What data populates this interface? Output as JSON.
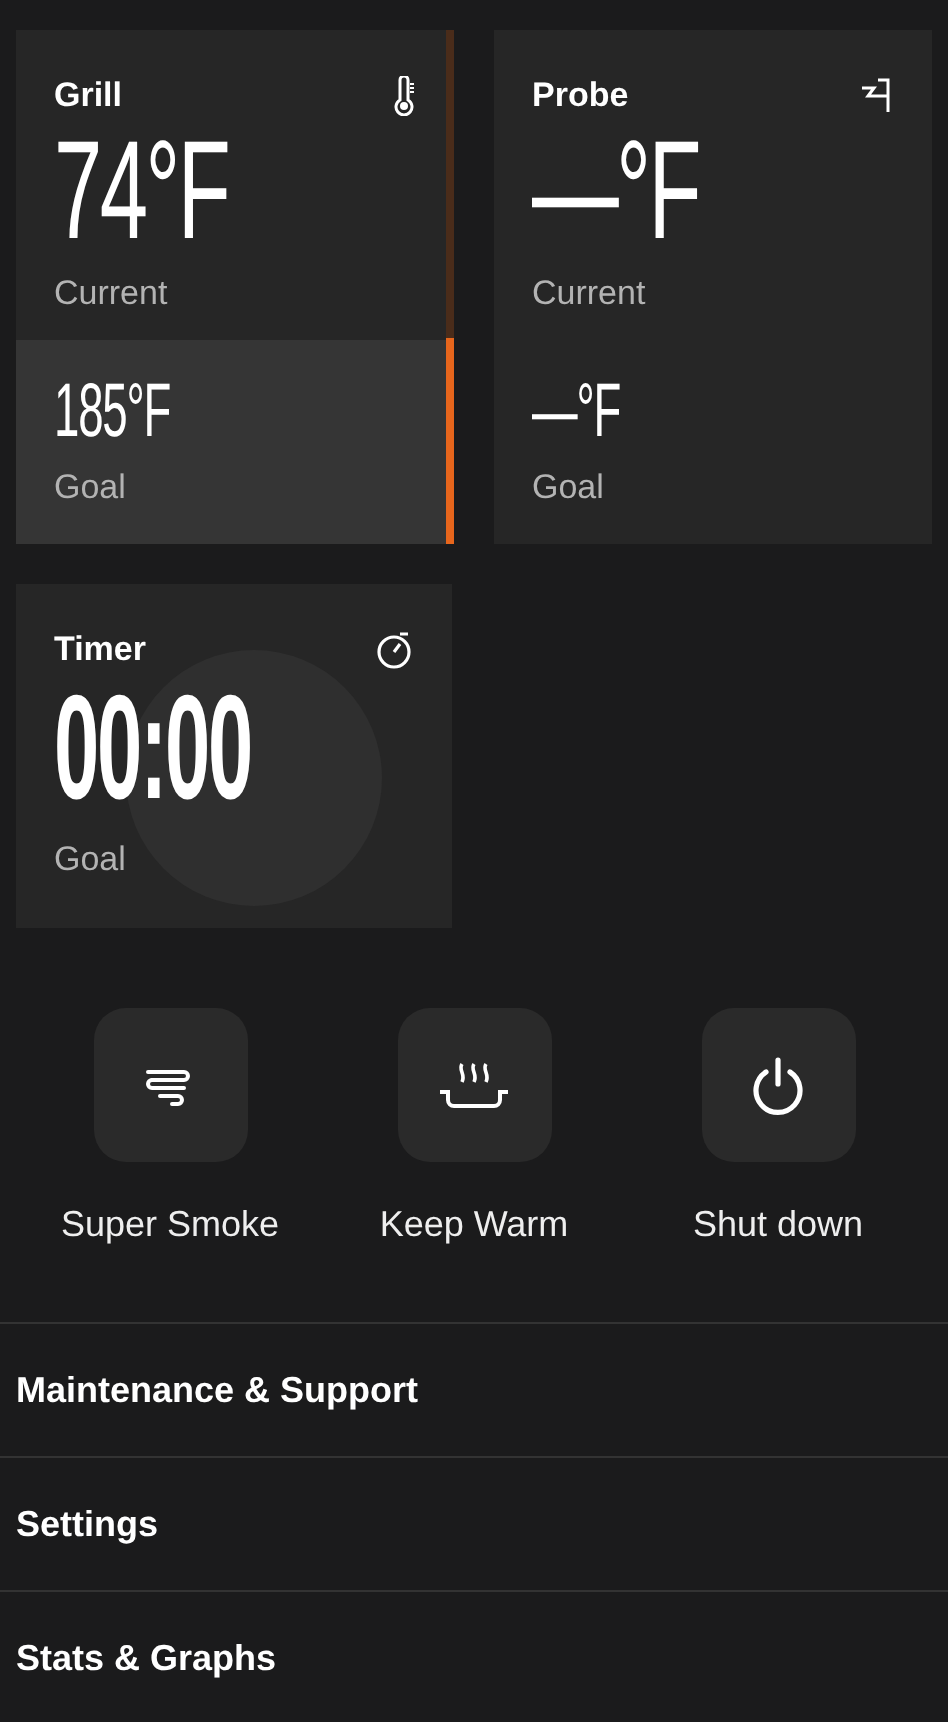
{
  "probes": [
    {
      "kind": "grill",
      "title": "Grill",
      "current": "74°F",
      "current_label": "Current",
      "goal": "185°F",
      "goal_label": "Goal",
      "active": true,
      "level": 0.4
    },
    {
      "kind": "probe",
      "title": "Probe",
      "current": "—°F",
      "current_label": "Current",
      "goal": "—°F",
      "goal_label": "Goal",
      "active": false
    }
  ],
  "timer": {
    "title": "Timer",
    "value": "00:00",
    "label": "Goal"
  },
  "actions": [
    {
      "kind": "smoke",
      "label": "Super Smoke"
    },
    {
      "kind": "warm",
      "label": "Keep Warm"
    },
    {
      "kind": "power",
      "label": "Shut down"
    }
  ],
  "menu": [
    "Maintenance & Support",
    "Settings",
    "Stats & Graphs"
  ]
}
